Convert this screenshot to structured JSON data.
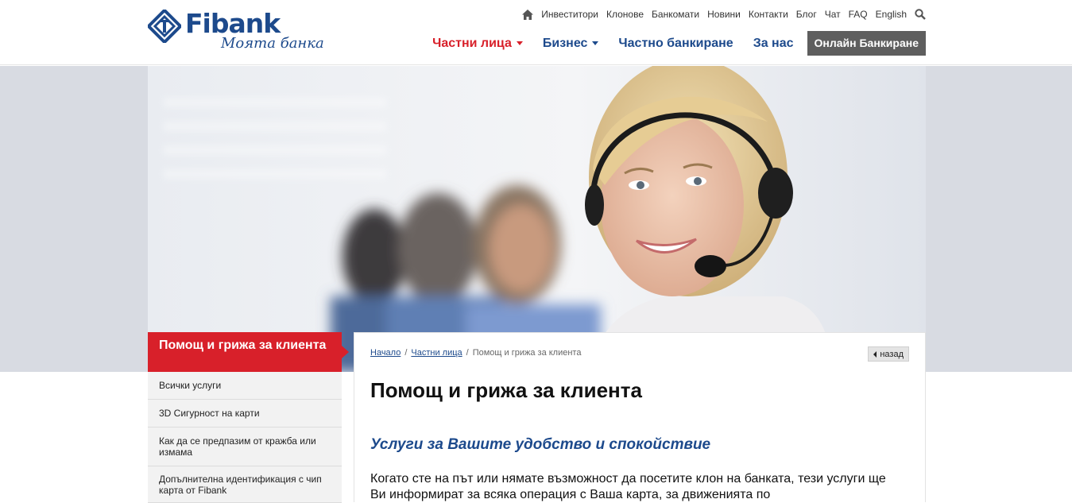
{
  "brand": {
    "name": "Fibank",
    "tagline": "Моята банка"
  },
  "util_nav": {
    "items": [
      "Инвеститори",
      "Клонове",
      "Банкомати",
      "Новини",
      "Контакти",
      "Блог",
      "Чат",
      "FAQ",
      "English"
    ]
  },
  "main_nav": {
    "items": [
      {
        "label": "Частни лица",
        "active": true,
        "dropdown": true
      },
      {
        "label": "Бизнес",
        "active": false,
        "dropdown": true
      },
      {
        "label": "Частно банкиране",
        "active": false,
        "dropdown": false
      },
      {
        "label": "За нас",
        "active": false,
        "dropdown": false
      }
    ],
    "online_banking": "Онлайн Банкиране"
  },
  "sidebar": {
    "title": "Помощ и грижа за клиента",
    "items": [
      {
        "label": "Всички услуги"
      },
      {
        "label": "3D Сигурност на карти"
      },
      {
        "label": "Как да се предпазим от кражба или измама"
      },
      {
        "label": "Допълнителна идентификация с чип карта от Fibank"
      }
    ]
  },
  "breadcrumb": {
    "home": "Начало",
    "section": "Частни лица",
    "current": "Помощ и грижа за клиента"
  },
  "back_label": "назад",
  "content": {
    "title": "Помощ и грижа за клиента",
    "subtitle": "Услуги за Вашите удобство и спокойствие",
    "body": "Когато сте на път или нямате възможност да посетите клон на банката, тези услуги ще Ви информират за всяка операция с Ваша карта, за движенията по"
  },
  "colors": {
    "brand_blue": "#1d4a8c",
    "accent_red": "#d8202a",
    "button_gray": "#5e5e5e"
  },
  "icons": {
    "home": "home-icon",
    "search": "search-icon",
    "back": "chevron-left-icon"
  }
}
